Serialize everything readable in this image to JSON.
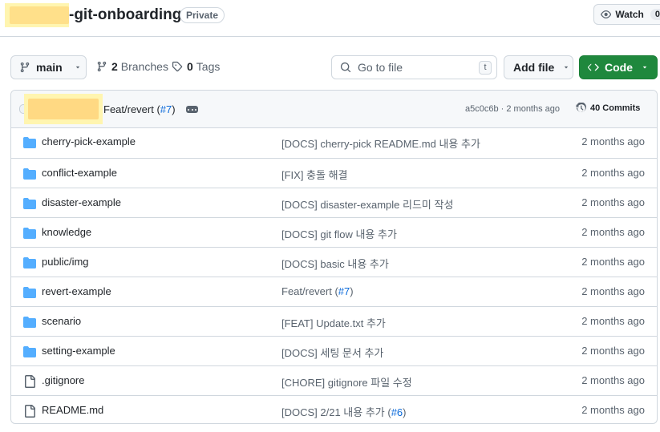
{
  "repo": {
    "name": "-git-onboarding",
    "visibility": "Private"
  },
  "watch": {
    "label": "Watch",
    "count": "0"
  },
  "toolbar": {
    "branch": "main",
    "branches_count": "2",
    "branches_label": "Branches",
    "tags_count": "0",
    "tags_label": "Tags",
    "goto_placeholder": "Go to file",
    "goto_shortcut": "t",
    "add_file_label": "Add file",
    "code_label": "Code"
  },
  "latest_commit": {
    "message": "Feat/revert (",
    "pr": "#7",
    "message_end": ")",
    "sha_time": "a5c0c6b · 2 months ago",
    "commits_label": "40 Commits"
  },
  "files": [
    {
      "type": "dir",
      "icon": "folder-icon",
      "name": "cherry-pick-example",
      "message": "[DOCS] cherry-pick README.md 내용 추가",
      "date": "2 months ago"
    },
    {
      "type": "dir",
      "icon": "folder-icon",
      "name": "conflict-example",
      "message": "[FIX] 충돌 해결",
      "date": "2 months ago"
    },
    {
      "type": "dir",
      "icon": "folder-icon",
      "name": "disaster-example",
      "message": "[DOCS] disaster-example 리드미 작성",
      "date": "2 months ago"
    },
    {
      "type": "dir",
      "icon": "folder-icon",
      "name": "knowledge",
      "message": "[DOCS] git flow 내용 추가",
      "date": "2 months ago"
    },
    {
      "type": "dir",
      "icon": "folder-icon",
      "name": "public/img",
      "message": "[DOCS] basic 내용 추가",
      "date": "2 months ago"
    },
    {
      "type": "dir",
      "icon": "folder-icon",
      "name": "revert-example",
      "message": "Feat/revert (",
      "pr": "#7",
      "message_end": ")",
      "date": "2 months ago"
    },
    {
      "type": "dir",
      "icon": "folder-icon",
      "name": "scenario",
      "message": "[FEAT] Update.txt 추가",
      "date": "2 months ago"
    },
    {
      "type": "dir",
      "icon": "folder-icon",
      "name": "setting-example",
      "message": "[DOCS] 세팅 문서 추가",
      "date": "2 months ago"
    },
    {
      "type": "file",
      "icon": "file-icon",
      "name": ".gitignore",
      "message": "[CHORE] gitignore 파일 수정",
      "date": "2 months ago"
    },
    {
      "type": "file",
      "icon": "file-icon",
      "name": "README.md",
      "message": "[DOCS] 2/21 내용 추가 (",
      "pr": "#6",
      "message_end": ")",
      "date": "2 months ago"
    }
  ],
  "colors": {
    "folder": "#54aeff",
    "link": "#0969da",
    "code_button": "#1f883d",
    "border": "#d0d7de",
    "muted": "#59636e"
  }
}
